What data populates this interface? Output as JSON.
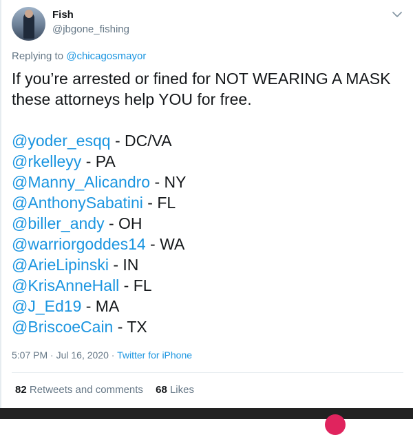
{
  "user": {
    "display_name": "Fish",
    "handle": "@jbgone_fishing"
  },
  "reply": {
    "prefix": "Replying to",
    "to": "@chicagosmayor"
  },
  "tweet": {
    "line1": "If you’re arrested or fined for NOT WEARING A MASK",
    "line2": "these attorneys help YOU for free.",
    "attorneys": [
      {
        "handle": "@yoder_esqq",
        "region": " - DC/VA"
      },
      {
        "handle": "@rkelleyy",
        "region": " - PA"
      },
      {
        "handle": "@Manny_Alicandro",
        "region": " - NY"
      },
      {
        "handle": "@AnthonySabatini",
        "region": " - FL"
      },
      {
        "handle": "@biller_andy",
        "region": " - OH"
      },
      {
        "handle": "@warriorgoddes14",
        "region": " - WA"
      },
      {
        "handle": "@ArieLipinski",
        "region": " - IN"
      },
      {
        "handle": "@KrisAnneHall",
        "region": " - FL"
      },
      {
        "handle": "@J_Ed19",
        "region": " - MA"
      },
      {
        "handle": "@BriscoeCain",
        "region": " - TX"
      }
    ]
  },
  "meta": {
    "time": "5:07 PM",
    "sep1": " · ",
    "date": "Jul 16, 2020",
    "sep2": " · ",
    "source": "Twitter for iPhone"
  },
  "stats": {
    "retweets_count": "82",
    "retweets_label": " Retweets and comments",
    "likes_count": "68",
    "likes_label": " Likes"
  },
  "icons": {
    "menu": "chevron-down-icon"
  },
  "colors": {
    "link": "#1b95e0",
    "muted": "#657786",
    "text": "#14171a"
  }
}
